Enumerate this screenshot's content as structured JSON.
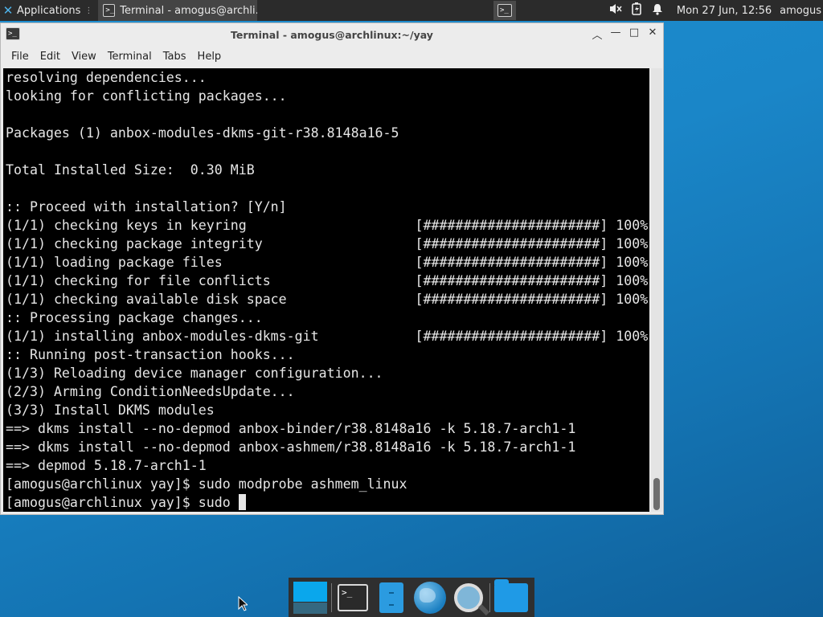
{
  "top_panel": {
    "applications_label": "Applications",
    "task_title": "Terminal - amogus@archli...",
    "clock": "Mon 27 Jun, 12:56",
    "user": "amogus"
  },
  "window": {
    "title": "Terminal - amogus@archlinux:~/yay",
    "menu": [
      "File",
      "Edit",
      "View",
      "Terminal",
      "Tabs",
      "Help"
    ]
  },
  "terminal": {
    "lines": [
      "resolving dependencies...",
      "looking for conflicting packages...",
      "",
      "Packages (1) anbox-modules-dkms-git-r38.8148a16-5",
      "",
      "Total Installed Size:  0.30 MiB",
      "",
      ":: Proceed with installation? [Y/n]",
      "(1/1) checking keys in keyring                     [######################] 100%",
      "(1/1) checking package integrity                   [######################] 100%",
      "(1/1) loading package files                        [######################] 100%",
      "(1/1) checking for file conflicts                  [######################] 100%",
      "(1/1) checking available disk space                [######################] 100%",
      ":: Processing package changes...",
      "(1/1) installing anbox-modules-dkms-git            [######################] 100%",
      ":: Running post-transaction hooks...",
      "(1/3) Reloading device manager configuration...",
      "(2/3) Arming ConditionNeedsUpdate...",
      "(3/3) Install DKMS modules",
      "==> dkms install --no-depmod anbox-binder/r38.8148a16 -k 5.18.7-arch1-1",
      "==> dkms install --no-depmod anbox-ashmem/r38.8148a16 -k 5.18.7-arch1-1",
      "==> depmod 5.18.7-arch1-1",
      "[amogus@archlinux yay]$ sudo modprobe ashmem_linux"
    ],
    "prompt_line": "[amogus@archlinux yay]$ sudo "
  },
  "icons": {
    "apps": "xfce-icon",
    "terminal": "terminal-icon",
    "volume": "volume-muted-icon",
    "battery": "battery-icon",
    "notifications": "bell-icon",
    "dock": [
      "show-desktop-icon",
      "terminal-icon",
      "file-cabinet-icon",
      "web-browser-icon",
      "search-icon",
      "folder-icon"
    ]
  }
}
